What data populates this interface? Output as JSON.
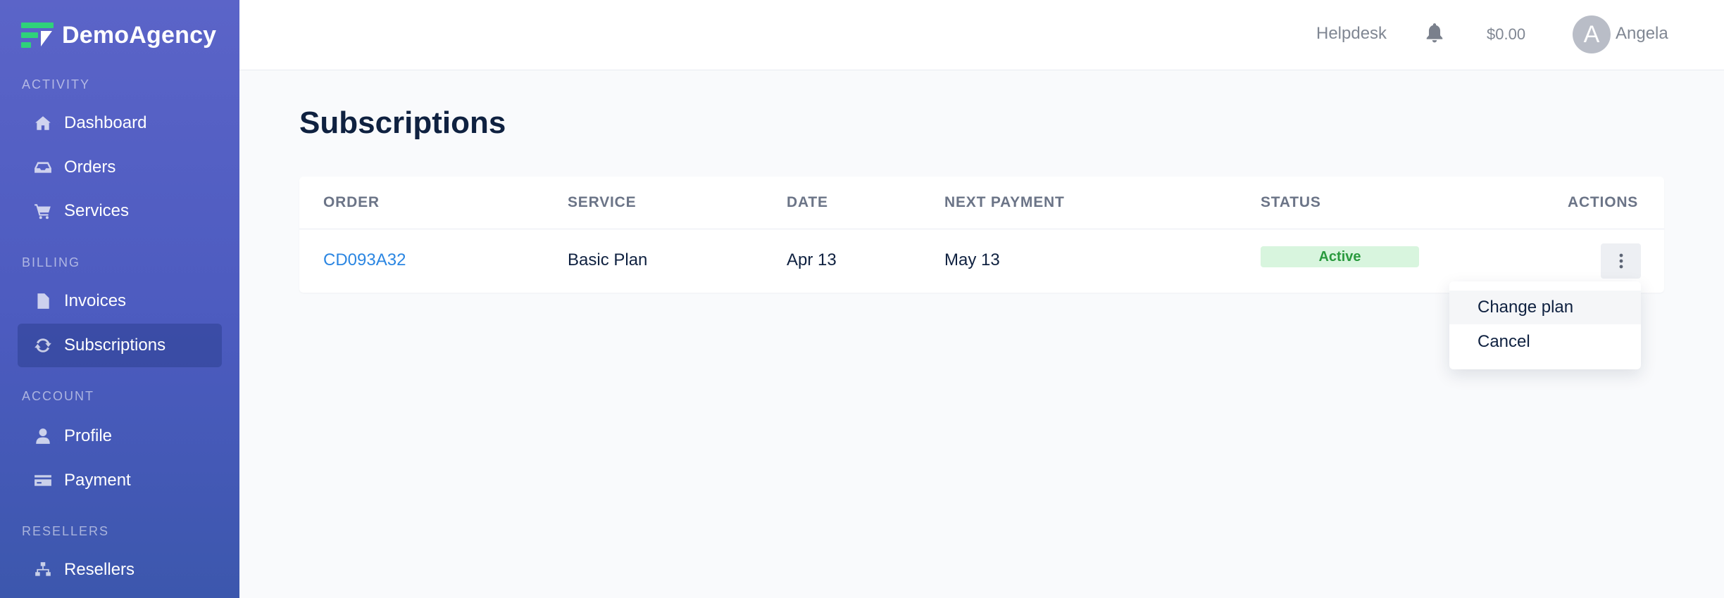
{
  "brand": {
    "name": "DemoAgency",
    "accent": "#2fd27a",
    "sidebar_color": "#4c5bbf"
  },
  "sidebar": {
    "sections": [
      {
        "label": "ACTIVITY"
      },
      {
        "label": "BILLING"
      },
      {
        "label": "ACCOUNT"
      },
      {
        "label": "RESELLERS"
      }
    ],
    "items": [
      {
        "label": "Dashboard",
        "icon": "home-icon"
      },
      {
        "label": "Orders",
        "icon": "inbox-icon"
      },
      {
        "label": "Services",
        "icon": "cart-icon"
      },
      {
        "label": "Invoices",
        "icon": "file-icon"
      },
      {
        "label": "Subscriptions",
        "icon": "refresh-icon",
        "active": true
      },
      {
        "label": "Profile",
        "icon": "user-icon"
      },
      {
        "label": "Payment",
        "icon": "credit-card-icon"
      },
      {
        "label": "Resellers",
        "icon": "sitemap-icon"
      }
    ]
  },
  "topbar": {
    "helpdesk": "Helpdesk",
    "balance": "$0.00",
    "avatar_initial": "A",
    "username": "Angela"
  },
  "main": {
    "title": "Subscriptions",
    "table": {
      "headers": [
        "ORDER",
        "SERVICE",
        "DATE",
        "NEXT PAYMENT",
        "STATUS",
        "ACTIONS"
      ],
      "rows": [
        {
          "order": "CD093A32",
          "service": "Basic Plan",
          "date": "Apr 13",
          "next_payment": "May 13",
          "status": "Active"
        }
      ]
    },
    "actions_menu": {
      "items": [
        "Change plan",
        "Cancel"
      ]
    }
  }
}
